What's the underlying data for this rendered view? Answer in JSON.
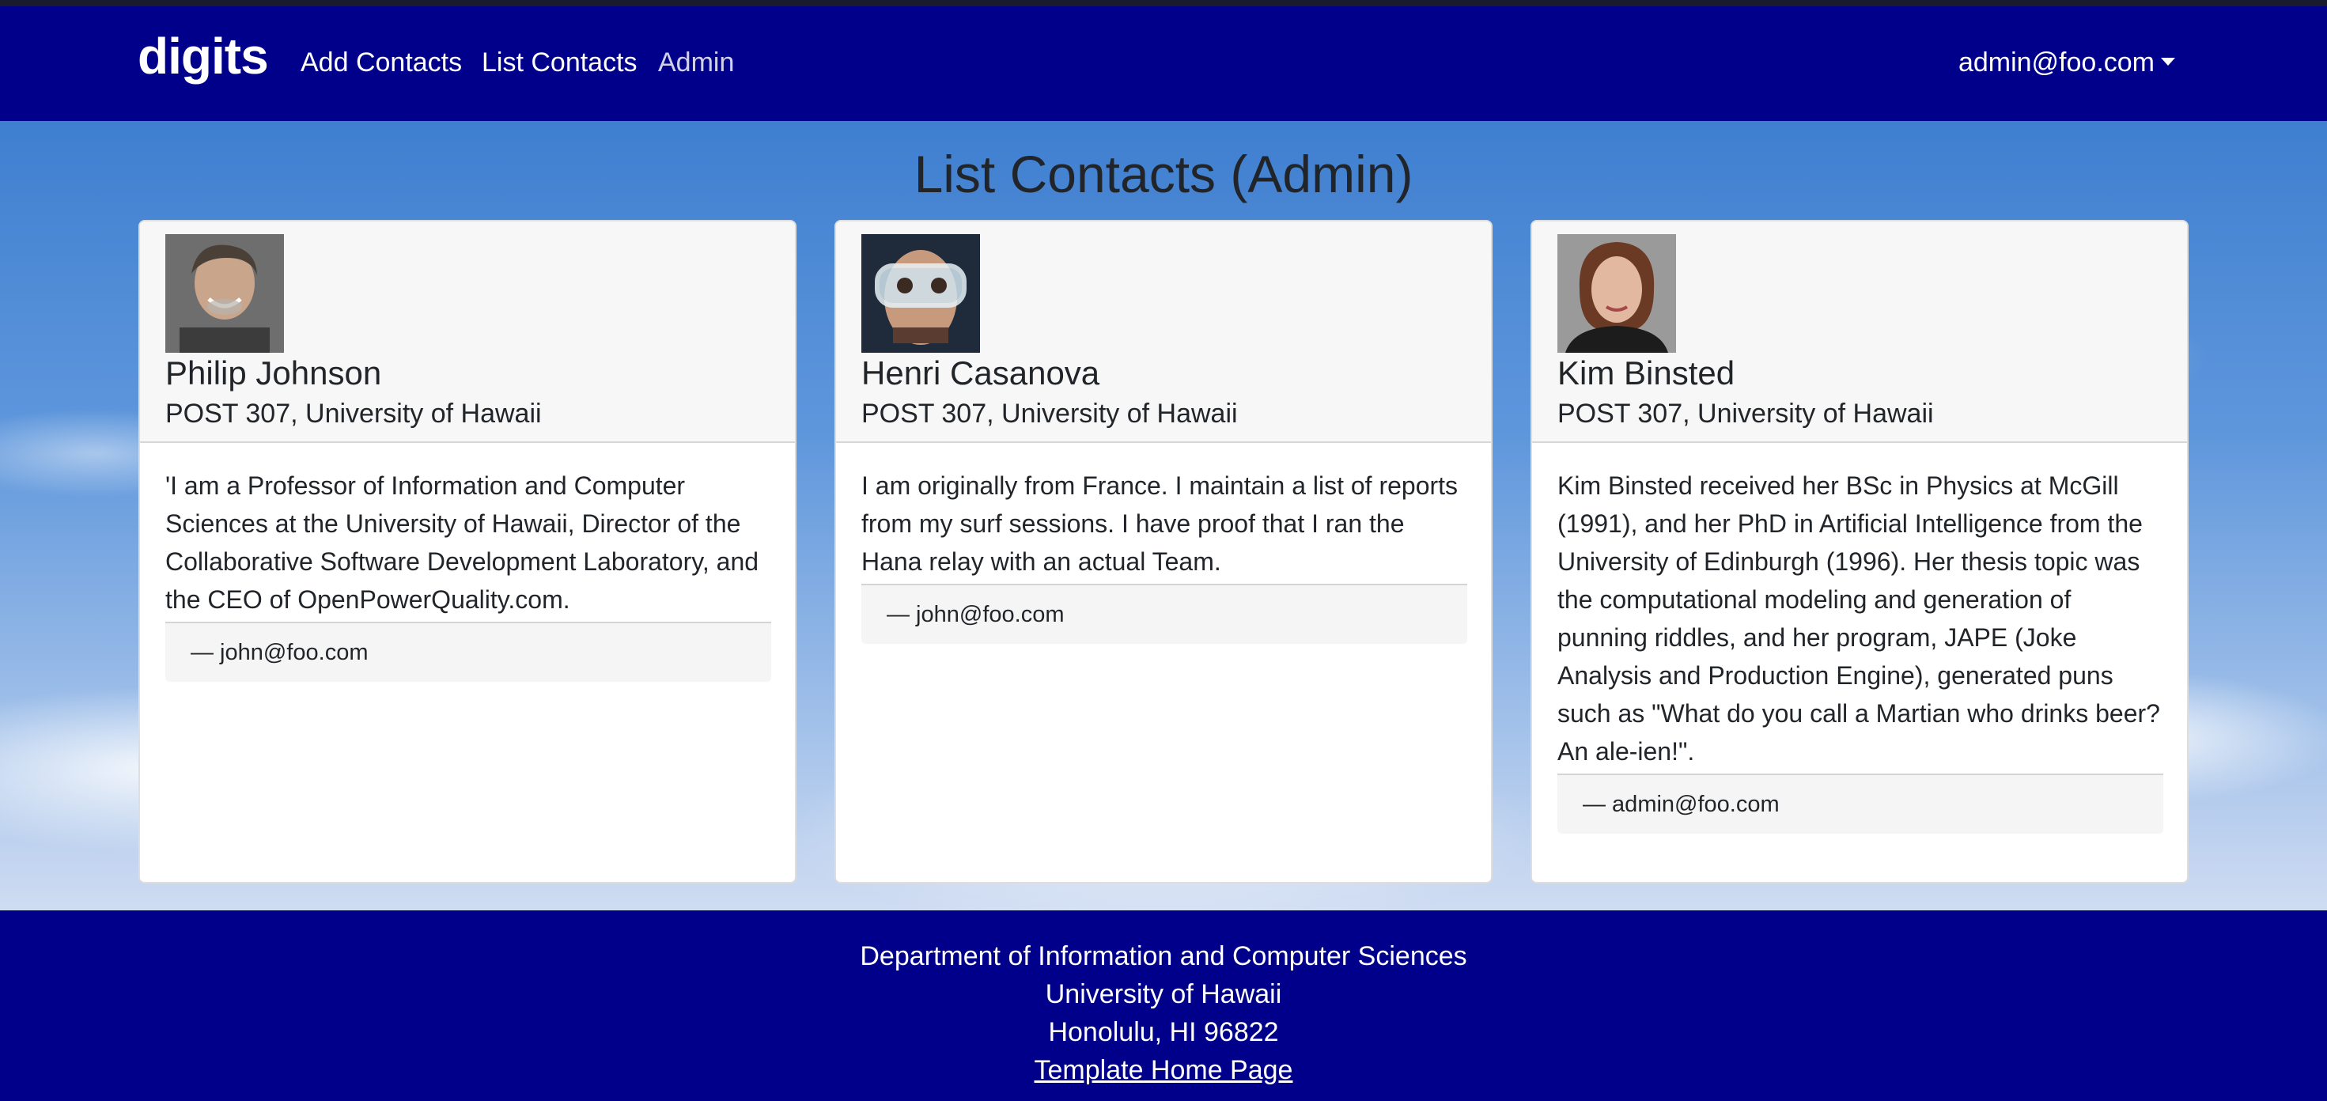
{
  "navbar": {
    "brand": "digits",
    "links": [
      {
        "label": "Add Contacts"
      },
      {
        "label": "List Contacts"
      },
      {
        "label": "Admin"
      }
    ],
    "user": "admin@foo.com"
  },
  "page": {
    "title": "List Contacts (Admin)"
  },
  "contacts": [
    {
      "name": "Philip Johnson",
      "address": "POST 307, University of Hawaii",
      "description": "'I am a Professor of Information and Computer Sciences at the University of Hawaii, Director of the Collaborative Software Development Laboratory, and the CEO of OpenPowerQuality.com.",
      "note": "— john@foo.com"
    },
    {
      "name": "Henri Casanova",
      "address": "POST 307, University of Hawaii",
      "description": "I am originally from France. I maintain a list of reports from my surf sessions. I have proof that I ran the Hana relay with an actual Team.",
      "note": "— john@foo.com"
    },
    {
      "name": "Kim Binsted",
      "address": "POST 307, University of Hawaii",
      "description": "Kim Binsted received her BSc in Physics at McGill (1991), and her PhD in Artificial Intelligence from the University of Edinburgh (1996). Her thesis topic was the computational modeling and generation of punning riddles, and her program, JAPE (Joke Analysis and Production Engine), generated puns such as \"What do you call a Martian who drinks beer? An ale-ien!\".",
      "note": "— admin@foo.com"
    }
  ],
  "footer": {
    "line1": "Department of Information and Computer Sciences",
    "line2": "University of Hawaii",
    "line3": "Honolulu, HI 96822",
    "link": "Template Home Page"
  },
  "colors": {
    "navbar": "#00008b",
    "footer": "#00008b",
    "card_header": "#f7f7f7"
  }
}
